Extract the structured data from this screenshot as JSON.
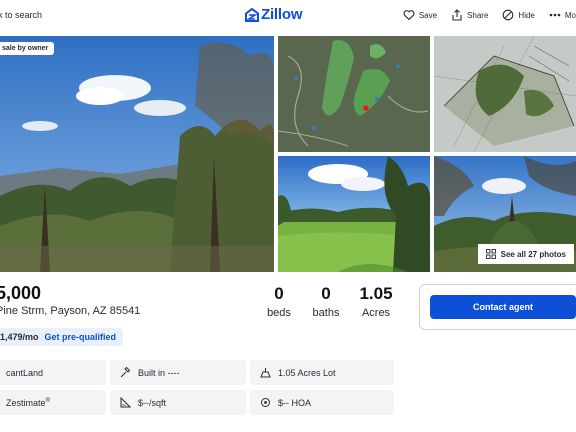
{
  "header": {
    "back_label": "k to search",
    "logo_text": "Zillow",
    "save_label": "Save",
    "share_label": "Share",
    "hide_label": "Hide",
    "more_label": "Mo"
  },
  "gallery": {
    "tag": "sale by owner",
    "see_all": "See all 27 photos"
  },
  "listing": {
    "price": "5,000",
    "address": "Pine Strm, Payson, AZ 85541",
    "beds_value": "0",
    "beds_label": "beds",
    "baths_value": "0",
    "baths_label": "baths",
    "acres_value": "1.05",
    "acres_label": "Acres",
    "payment": "1,479/mo",
    "prequal": "Get pre-qualified"
  },
  "facts": {
    "type": "cantLand",
    "built": "Built in ----",
    "lot": "1.05 Acres Lot",
    "zestimate": "Zestimate",
    "zestimate_mark": "®",
    "ppsf": "$--/sqft",
    "hoa": "$-- HOA"
  },
  "contact": {
    "button": "Contact agent"
  },
  "colors": {
    "brand": "#0d4fd6",
    "chip_bg": "#e8f1fb",
    "fact_bg": "#f4f4f6"
  }
}
